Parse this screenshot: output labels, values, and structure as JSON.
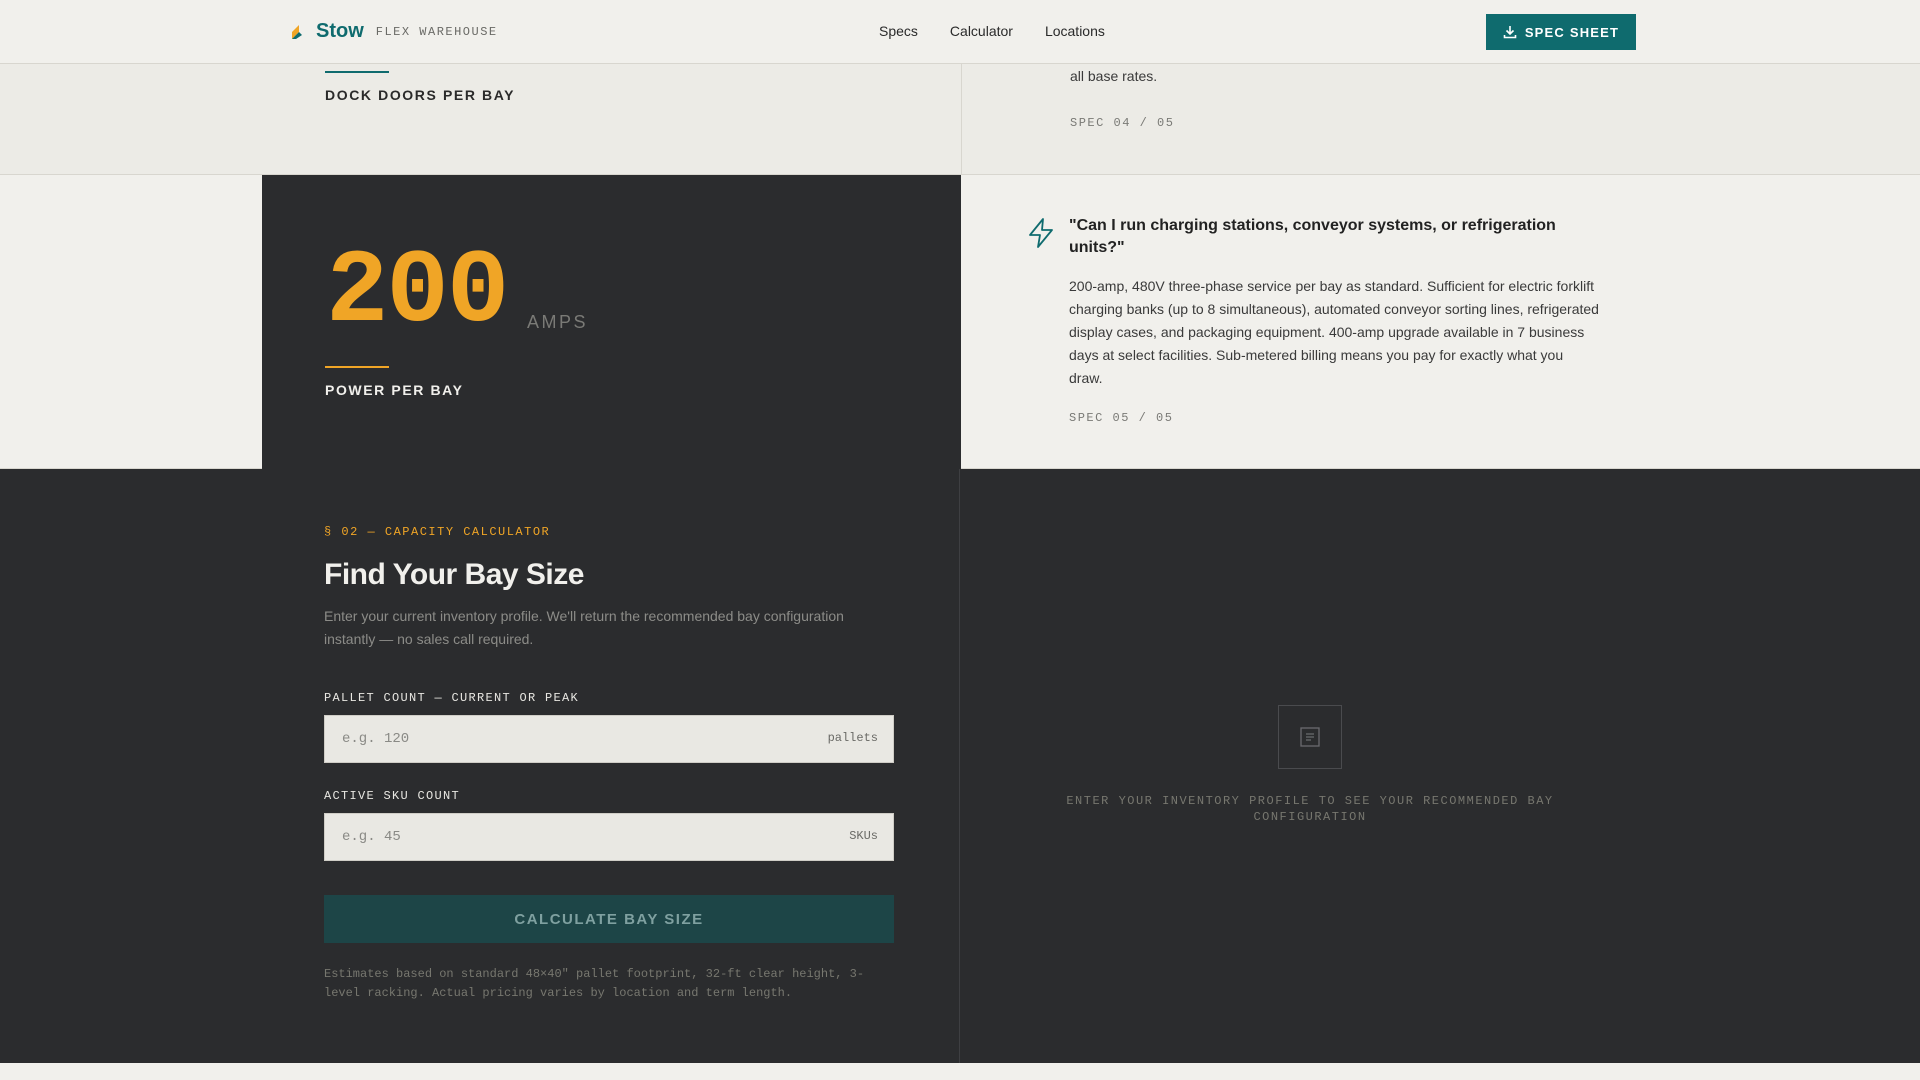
{
  "nav": {
    "brand": "Stow",
    "brand_sub": "FLEX WAREHOUSE",
    "links": [
      "Specs",
      "Calculator",
      "Locations"
    ],
    "cta": "SPEC SHEET"
  },
  "spec4": {
    "label": "DOCK DOORS PER BAY",
    "text_tail": "all base rates.",
    "index": "SPEC 04 / 05"
  },
  "spec5": {
    "value": "200",
    "unit": "AMPS",
    "label": "POWER PER BAY",
    "question": "\"Can I run charging stations, conveyor systems, or refrigeration units?\"",
    "answer": "200-amp, 480V three-phase service per bay as standard. Sufficient for electric forklift charging banks (up to 8 simultaneous), automated conveyor sorting lines, refrigerated display cases, and packaging equipment. 400-amp upgrade available in 7 business days at select facilities. Sub-metered billing means you pay for exactly what you draw.",
    "index": "SPEC 05 / 05"
  },
  "calculator": {
    "eyebrow": "§ 02 — CAPACITY CALCULATOR",
    "title": "Find Your Bay Size",
    "description": "Enter your current inventory profile. We'll return the recommended bay configuration instantly — no sales call required.",
    "pallet_label": "PALLET COUNT — CURRENT OR PEAK",
    "pallet_placeholder": "e.g. 120",
    "pallet_unit": "pallets",
    "sku_label": "ACTIVE SKU COUNT",
    "sku_placeholder": "e.g. 45",
    "sku_unit": "SKUs",
    "button": "CALCULATE BAY SIZE",
    "footnote": "Estimates based on standard 48×40\" pallet footprint, 32-ft clear height, 3-level racking. Actual pricing varies by location and term length.",
    "empty_message": "ENTER YOUR INVENTORY PROFILE TO SEE YOUR RECOMMENDED BAY CONFIGURATION"
  },
  "colors": {
    "brand": "#0f6b6e",
    "accent": "#f0a526",
    "dark": "#2b2c2e"
  }
}
